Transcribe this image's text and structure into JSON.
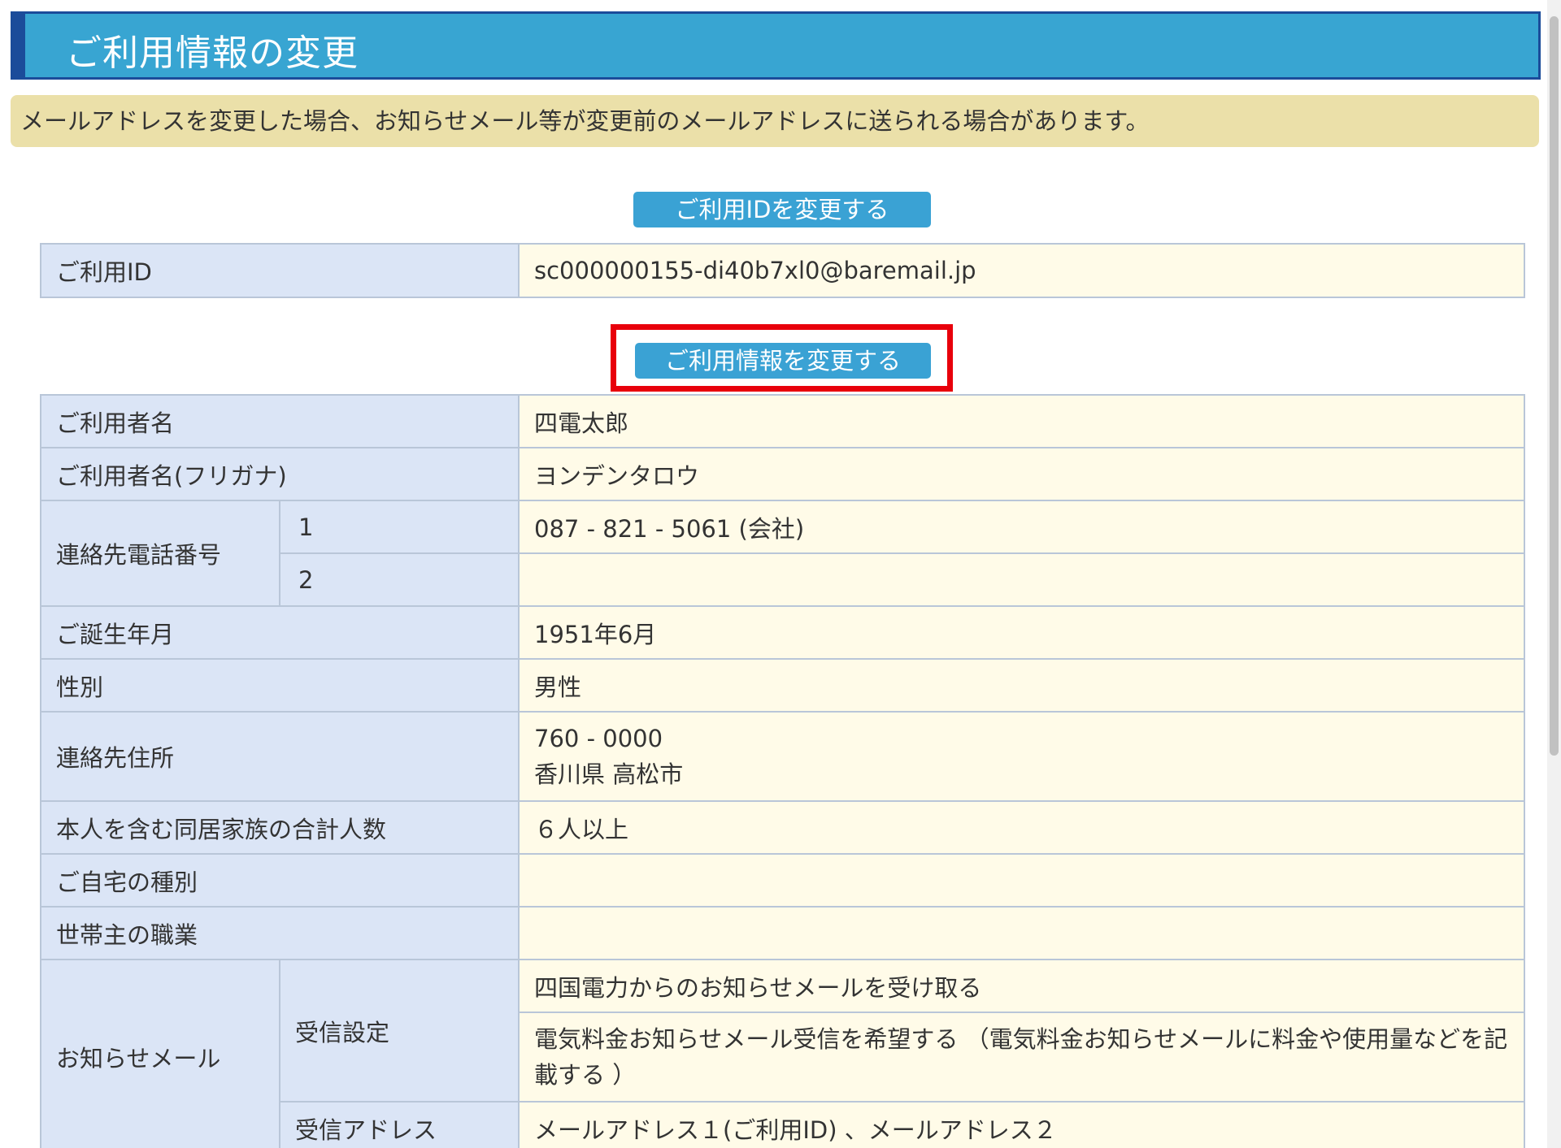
{
  "header": {
    "title": "ご利用情報の変更"
  },
  "notice": {
    "text": "メールアドレスを変更した場合、お知らせメール等が変更前のメールアドレスに送られる場合があります。"
  },
  "buttons": {
    "change_id": "ご利用IDを変更する",
    "change_info": "ご利用情報を変更する"
  },
  "user_id": {
    "label": "ご利用ID",
    "value": "sc000000155-di40b7xl0@baremail.jp"
  },
  "info": {
    "name": {
      "label": "ご利用者名",
      "value": "四電太郎"
    },
    "furigana": {
      "label": "ご利用者名(フリガナ)",
      "value": "ヨンデンタロウ"
    },
    "phone": {
      "label": "連絡先電話番号",
      "rows": [
        {
          "num": "1",
          "value": "087 - 821 - 5061 (会社)"
        },
        {
          "num": "2",
          "value": ""
        }
      ]
    },
    "birth": {
      "label": "ご誕生年月",
      "value": "1951年6月"
    },
    "gender": {
      "label": "性別",
      "value": "男性"
    },
    "address": {
      "label": "連絡先住所",
      "postal": "760 - 0000",
      "city": "香川県 高松市"
    },
    "household": {
      "label": "本人を含む同居家族の合計人数",
      "value": "６人以上"
    },
    "home_type": {
      "label": "ご自宅の種別",
      "value": ""
    },
    "occupation": {
      "label": "世帯主の職業",
      "value": ""
    },
    "mail": {
      "label": "お知らせメール",
      "receive_label": "受信設定",
      "receive_1": "四国電力からのお知らせメールを受け取る",
      "receive_2": "電気料金お知らせメール受信を希望する （電気料金お知らせメールに料金や使用量などを記載する ）",
      "address_label": "受信アドレス",
      "address_value": "メールアドレス１(ご利用ID) 、メールアドレス２"
    }
  }
}
